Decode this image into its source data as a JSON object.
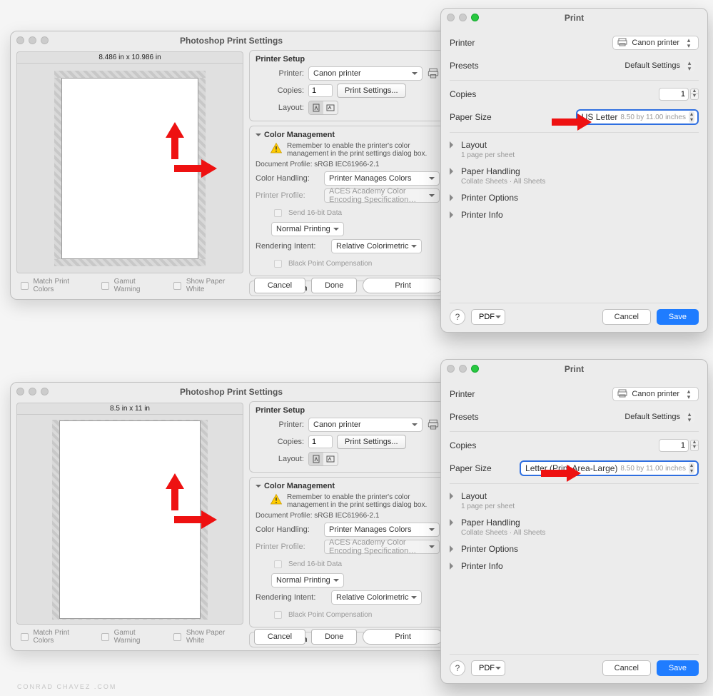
{
  "ps_window_title": "Photoshop Print Settings",
  "print_dialog_title": "Print",
  "printer_setup": {
    "heading": "Printer Setup",
    "printer_label": "Printer:",
    "printer_value": "Canon printer",
    "copies_label": "Copies:",
    "copies_value": "1",
    "print_settings_btn": "Print Settings...",
    "layout_label": "Layout:"
  },
  "color_mgmt": {
    "heading": "Color Management",
    "warning": "Remember to enable the printer's color management in the print settings dialog box.",
    "doc_profile": "Document Profile: sRGB IEC61966-2.1",
    "color_handling_label": "Color Handling:",
    "color_handling_value": "Printer Manages Colors",
    "printer_profile_label": "Printer Profile:",
    "printer_profile_value": "ACES Academy Color Encoding Specification…",
    "send16bit": "Send 16-bit Data",
    "normal_printing": "Normal Printing",
    "rendering_intent_label": "Rendering Intent:",
    "rendering_intent_value": "Relative Colorimetric",
    "bpc": "Black Point Compensation"
  },
  "description_heading": "Description",
  "ps_checks": {
    "match": "Match Print Colors",
    "gamut": "Gamut Warning",
    "paperwhite": "Show Paper White"
  },
  "ps_buttons": {
    "cancel": "Cancel",
    "done": "Done",
    "print": "Print"
  },
  "dim_a": "8.486 in x 10.986 in",
  "dim_b": "8.5 in x 11 in",
  "print_dialog": {
    "printer_label": "Printer",
    "printer_value": "Canon printer",
    "presets_label": "Presets",
    "presets_value": "Default Settings",
    "copies_label": "Copies",
    "copies_value": "1",
    "paper_size_label": "Paper Size",
    "paper_a_name": "US Letter",
    "paper_a_dim": "8.50 by 11.00 inches",
    "paper_b_name": "Letter (Print Area-Large)",
    "paper_b_dim": "8.50 by 11.00 inches",
    "layout": "Layout",
    "layout_sub": "1 page per sheet",
    "paper_handling": "Paper Handling",
    "paper_handling_sub": "Collate Sheets · All Sheets",
    "printer_options": "Printer Options",
    "printer_info": "Printer Info",
    "pdf_label": "PDF",
    "help": "?",
    "cancel": "Cancel",
    "save": "Save"
  },
  "watermark": "CONRAD CHAVEZ .COM"
}
